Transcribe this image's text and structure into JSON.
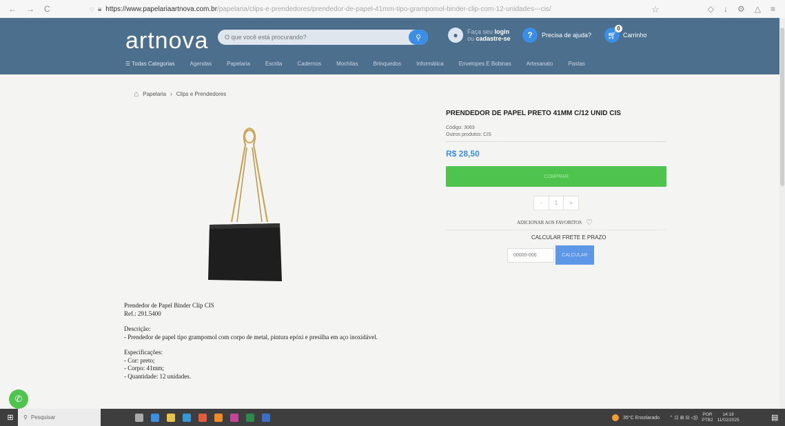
{
  "browser": {
    "back": "←",
    "forward": "→",
    "reload": "C",
    "url_host": "https://www.papelariaartnova.com.br",
    "url_path": "/papelaria/clips-e-prendedores/prendedor-de-papel-41mm-tipo-grampomol-binder-clip-com-12-unidades---cis/"
  },
  "header": {
    "logo": "artnova",
    "search_placeholder": "O que você está procurando?",
    "user_line1": "Faça seu",
    "user_login": "login",
    "user_line2": "ou",
    "user_register": "cadastre-se",
    "help_label": "Precisa de ajuda?",
    "cart_label": "Carrinho",
    "cart_count": "0"
  },
  "categories": [
    "Todas Categorias",
    "Agendas",
    "Papelaria",
    "Escrita",
    "Cadernos",
    "Mochilas",
    "Brinquedos",
    "Informática",
    "Envelopes E Bobinas",
    "Artesanato",
    "Pastas"
  ],
  "breadcrumb": {
    "level1": "Papelaria",
    "separator": "›",
    "level2": "Clips e Prendedores"
  },
  "product": {
    "title": "PRENDEDOR DE PAPEL PRETO 41MM C/12 UNID CIS",
    "code_label": "Código: 3063",
    "others_label": "Outros produtos:",
    "others_value": "CIS",
    "price": "R$ 28,50",
    "buy_label": "COMPRAR",
    "qty_minus": "-",
    "qty_value": "1",
    "qty_plus": "+",
    "favorites_label": "ADICIONAR AOS FAVORITOS",
    "freight_label": "CALCULAR FRETE E PRAZO",
    "cep_placeholder": "00000-000",
    "calc_label": "CALCULAR"
  },
  "description": {
    "line1": "Prendedor de Papel Binder Clip CIS",
    "line2": "Ref.: 291.5400",
    "desc_title": "Descrição:",
    "desc_text": "- Prendedor de papel tipo grampomol com corpo de metal, pintura epóxi e presilha em aço inoxidável.",
    "spec_title": "Especificações:",
    "spec1": "- Cor: preto;",
    "spec2": "- Corpo: 41mm;",
    "spec3": "- Quantidade: 12 unidades."
  },
  "taskbar": {
    "search_label": "Pesquisar",
    "weather": "35°C Ensolarado",
    "lang": "POR",
    "lang2": "PTB2",
    "time": "14:18",
    "date": "11/02/2025"
  },
  "colors": {
    "header_bg": "#4d6f8e",
    "accent": "#3a8ee6",
    "buy": "#4ec44e"
  }
}
